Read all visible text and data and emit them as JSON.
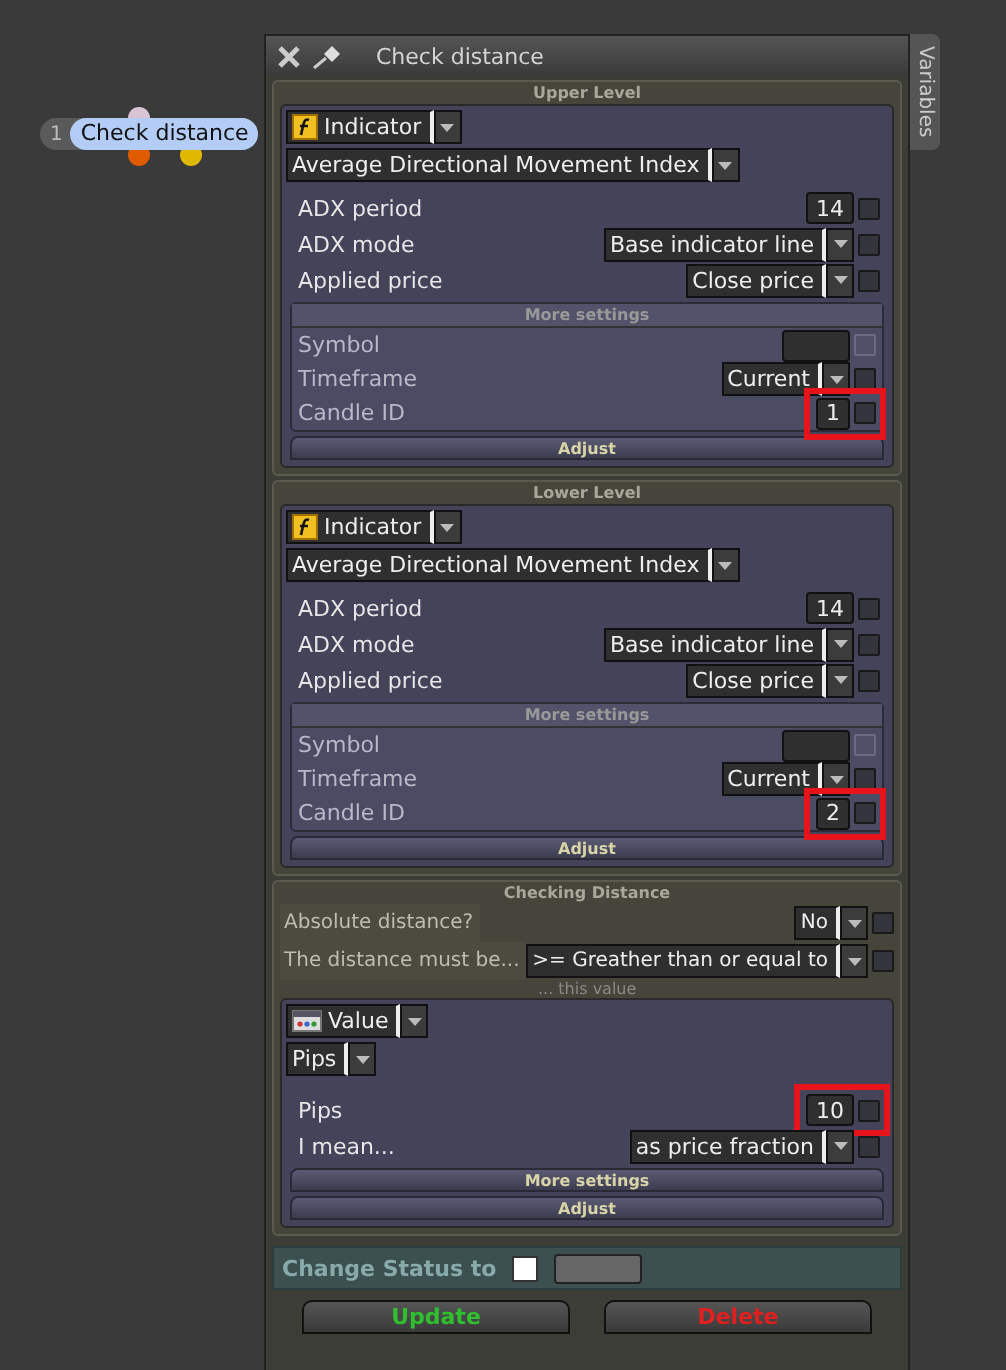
{
  "node": {
    "number": "1",
    "label": "Check distance"
  },
  "window": {
    "title": "Check distance",
    "side_tab": "Variables"
  },
  "levels": [
    {
      "title": "Upper Level",
      "source": {
        "kind": "function",
        "label": "Indicator"
      },
      "indicator": "Average Directional Movement Index",
      "params": [
        {
          "label": "ADX period",
          "kind": "number",
          "value": "14",
          "checked": false
        },
        {
          "label": "ADX mode",
          "kind": "select",
          "value": "Base indicator line",
          "checked": false
        },
        {
          "label": "Applied price",
          "kind": "select",
          "value": "Close price",
          "checked": false
        }
      ],
      "more_settings": {
        "title": "More settings",
        "params": [
          {
            "label": "Symbol",
            "kind": "blank",
            "checked": false
          },
          {
            "label": "Timeframe",
            "kind": "select",
            "value": "Current",
            "checked": false
          },
          {
            "label": "Candle ID",
            "kind": "number",
            "value": "1",
            "highlighted": true,
            "checked": false
          }
        ]
      },
      "adjust": "Adjust"
    },
    {
      "title": "Lower Level",
      "source": {
        "kind": "function",
        "label": "Indicator"
      },
      "indicator": "Average Directional Movement Index",
      "params": [
        {
          "label": "ADX period",
          "kind": "number",
          "value": "14",
          "checked": false
        },
        {
          "label": "ADX mode",
          "kind": "select",
          "value": "Base indicator line",
          "checked": false
        },
        {
          "label": "Applied price",
          "kind": "select",
          "value": "Close price",
          "checked": false
        }
      ],
      "more_settings": {
        "title": "More settings",
        "params": [
          {
            "label": "Symbol",
            "kind": "blank",
            "checked": false
          },
          {
            "label": "Timeframe",
            "kind": "select",
            "value": "Current",
            "checked": false
          },
          {
            "label": "Candle ID",
            "kind": "number",
            "value": "2",
            "highlighted": true,
            "checked": false
          }
        ]
      },
      "adjust": "Adjust"
    }
  ],
  "checking": {
    "title": "Checking Distance",
    "rows": [
      {
        "label": "Absolute distance?",
        "value": "No",
        "checked": false
      },
      {
        "label": "The distance must be...",
        "value": ">= Greather than or equal to",
        "checked": false
      }
    ],
    "caption": "... this value",
    "source": {
      "kind": "value",
      "label": "Value"
    },
    "unit": "Pips",
    "params": [
      {
        "label": "Pips",
        "kind": "number",
        "value": "10",
        "highlighted": true,
        "checked": false
      },
      {
        "label": "I mean...",
        "kind": "select",
        "value": "as price fraction",
        "checked": false
      }
    ],
    "more_settings": "More settings",
    "adjust": "Adjust"
  },
  "status": {
    "label": "Change Status to"
  },
  "buttons": [
    {
      "label": "Update",
      "kind": "update"
    },
    {
      "label": "Delete",
      "kind": "delete"
    }
  ]
}
